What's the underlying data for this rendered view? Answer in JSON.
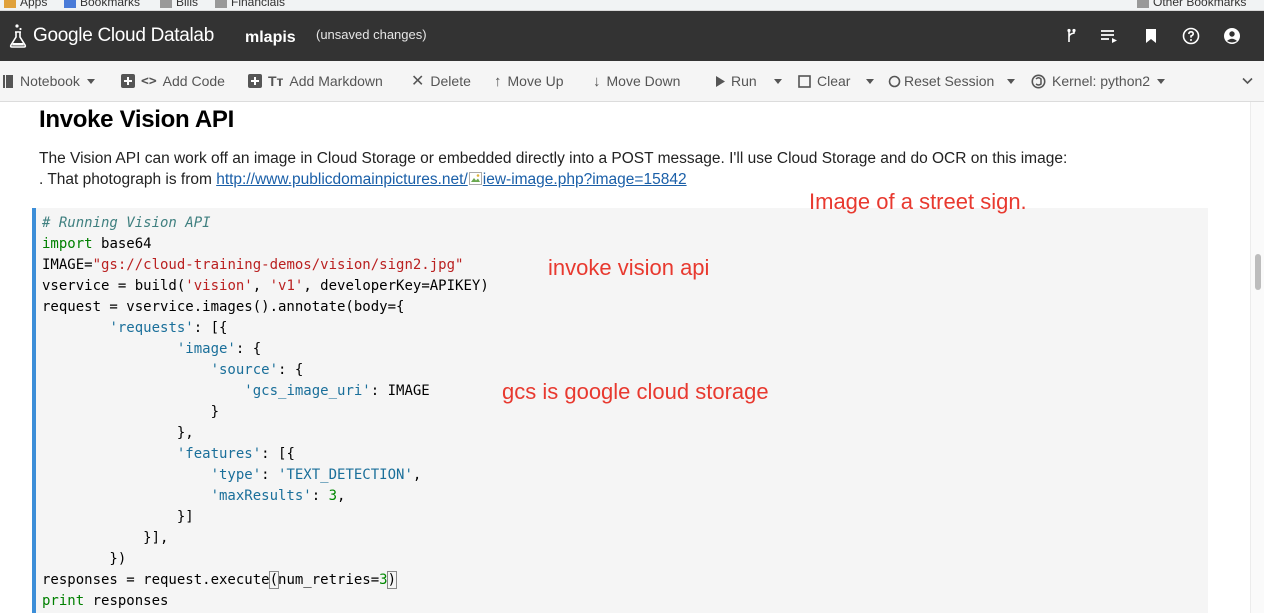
{
  "bookmarks": [
    "Apps",
    "Bookmarks",
    "Bills",
    "Financials",
    "Other Bookmarks"
  ],
  "header": {
    "brand": "Google Cloud Datalab",
    "notebook_name": "mlapis",
    "status": "(unsaved changes)",
    "icons": [
      "branch-icon",
      "list-icon",
      "bookmark-icon",
      "help-icon",
      "account-icon"
    ]
  },
  "toolbar": {
    "notebook": "Notebook",
    "add_code": "Add Code",
    "add_markdown": "Add Markdown",
    "delete": "Delete",
    "move_up": "Move Up",
    "move_down": "Move Down",
    "run": "Run",
    "clear": "Clear",
    "reset_session": "Reset Session",
    "kernel": "Kernel: python2"
  },
  "markdown": {
    "title": "Invoke Vision API",
    "paragraph_line1": "The Vision API can work off an image in Cloud Storage or embedded directly into a POST message. I'll use Cloud Storage and do OCR on this image:",
    "paragraph_line2_prefix": ". That photograph is from ",
    "link_part1": "http://www.publicdomainpictures.net/",
    "link_part2": "iew-image.php?image=15842"
  },
  "code": {
    "comment": "# Running Vision API",
    "import_module": "base64",
    "image_path": "\"gs://cloud-training-demos/vision/sign2.jpg\""
  },
  "annotations": {
    "street_sign": "Image of a street sign.",
    "invoke": "invoke vision api",
    "gcs": "gcs is google cloud storage"
  },
  "colors": {
    "header_bg": "#333333",
    "toolbar_bg": "#f5f5f5",
    "cell_border": "#3c8ed8",
    "annotation": "#e8392f"
  }
}
